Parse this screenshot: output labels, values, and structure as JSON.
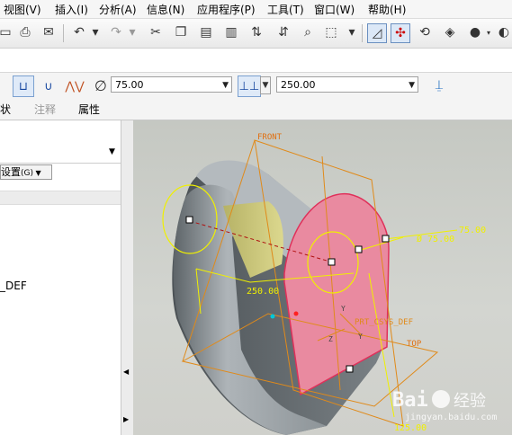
{
  "menu": {
    "items": [
      "视图(V)",
      "插入(I)",
      "分析(A)",
      "信息(N)",
      "应用程序(P)",
      "工具(T)",
      "窗口(W)",
      "帮助(H)"
    ]
  },
  "dashboard": {
    "diameter_value": "75.00",
    "depth_value": "250.00",
    "tabs": [
      "状",
      "注释",
      "属性"
    ]
  },
  "left_panel": {
    "settings_label": "设置",
    "settings_shortcut": "(G)",
    "tree_item": "_DEF"
  },
  "viewport": {
    "labels": {
      "front": "FRONT",
      "diameter": "Ø 75.00",
      "offset": "75.00",
      "depth": "250.00",
      "csys": "PRT_CSYS_DEF",
      "top": "TOP",
      "y1": "Y",
      "y2": "Y",
      "z": "Z",
      "bottom_dim": "125.00"
    }
  },
  "watermark": {
    "brand": "Bai",
    "brand_cn": "经验",
    "url": "jingyan.baidu.com"
  }
}
